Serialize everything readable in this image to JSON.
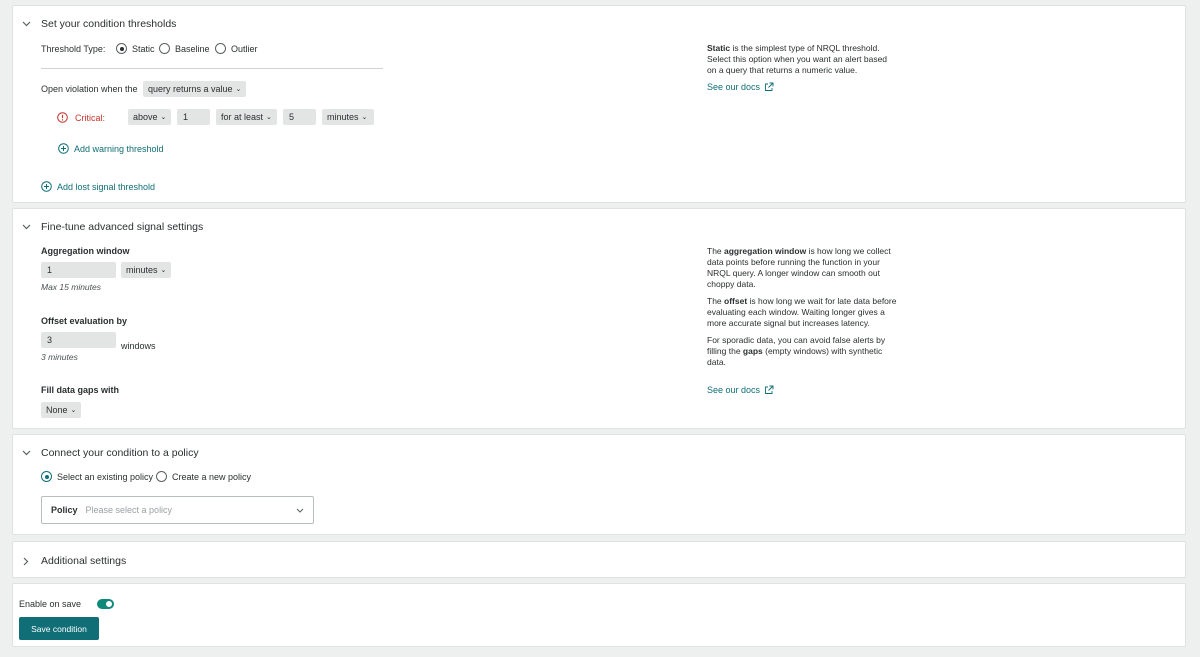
{
  "colors": {
    "accent": "#0f6e76",
    "critical": "#c4352b",
    "toggle_on": "#0f8a7a",
    "page_bg": "#eef0f0"
  },
  "thresholds": {
    "title": "Set your condition thresholds",
    "threshold_type_label": "Threshold Type:",
    "types": [
      {
        "label": "Static",
        "selected": true
      },
      {
        "label": "Baseline",
        "selected": false
      },
      {
        "label": "Outlier",
        "selected": false
      }
    ],
    "open_violation_label": "Open violation when the",
    "open_violation_value": "query returns a value",
    "critical_label": "Critical:",
    "operator": "above",
    "threshold_value": "1",
    "occurrence": "for at least",
    "duration_value": "5",
    "duration_unit": "minutes",
    "add_warning": "Add warning threshold",
    "add_lost_signal": "Add lost signal threshold",
    "help_bold": "Static",
    "help_text": " is the simplest type of NRQL threshold. Select this option when you want an alert based on a query that returns a numeric value.",
    "docs_link": "See our docs"
  },
  "signal": {
    "title": "Fine-tune advanced signal settings",
    "aggregation_label": "Aggregation window",
    "aggregation_value": "1",
    "aggregation_unit": "minutes",
    "aggregation_hint": "Max 15 minutes",
    "offset_label": "Offset evaluation by",
    "offset_value": "3",
    "offset_unit": "windows",
    "offset_hint": "3 minutes",
    "fill_label": "Fill data gaps with",
    "fill_value": "None",
    "help1_pre": "The ",
    "help1_bold": "aggregation window",
    "help1_post": " is how long we collect data points before running the function in your NRQL query. A longer window can smooth out choppy data.",
    "help2_pre": "The ",
    "help2_bold": "offset",
    "help2_post": " is how long we wait for late data before evaluating each window. Waiting longer gives a more accurate signal but increases latency.",
    "help3_pre": "For sporadic data, you can avoid false alerts by filling the ",
    "help3_bold": "gaps",
    "help3_post": " (empty windows) with synthetic data.",
    "docs_link": "See our docs"
  },
  "policy": {
    "title": "Connect your condition to a policy",
    "options": [
      {
        "label": "Select an existing policy",
        "selected": true
      },
      {
        "label": "Create a new policy",
        "selected": false
      }
    ],
    "field_label": "Policy",
    "placeholder": "Please select a policy"
  },
  "additional": {
    "title": "Additional settings"
  },
  "footer": {
    "enable_label": "Enable on save",
    "enabled": true,
    "save_label": "Save condition"
  }
}
